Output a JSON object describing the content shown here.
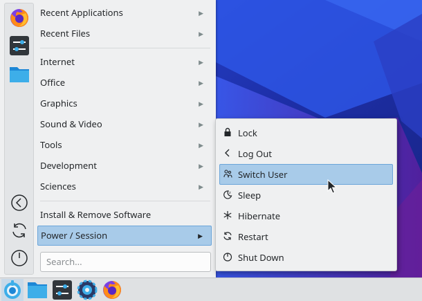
{
  "menu": {
    "items": [
      {
        "label": "Recent Applications",
        "arrow": "▶"
      },
      {
        "label": "Recent Files",
        "arrow": "▶"
      },
      {
        "label": "Internet",
        "arrow": "▶"
      },
      {
        "label": "Office",
        "arrow": "▶"
      },
      {
        "label": "Graphics",
        "arrow": "▶"
      },
      {
        "label": "Sound & Video",
        "arrow": "▶"
      },
      {
        "label": "Tools",
        "arrow": "▶"
      },
      {
        "label": "Development",
        "arrow": "▶"
      },
      {
        "label": "Sciences",
        "arrow": "▶"
      },
      {
        "label": "Install & Remove Software"
      },
      {
        "label": "Power / Session",
        "arrow": "▶"
      }
    ],
    "search_placeholder": "Search..."
  },
  "favorites": [
    "firefox-icon",
    "system-settings-icon",
    "file-manager-icon"
  ],
  "strip_actions": [
    "back-icon",
    "refresh-icon",
    "power-icon"
  ],
  "submenu": {
    "items": [
      {
        "label": "Lock",
        "icon": "lock-icon"
      },
      {
        "label": "Log Out",
        "icon": "logout-icon"
      },
      {
        "label": "Switch User",
        "icon": "switch-user-icon"
      },
      {
        "label": "Sleep",
        "icon": "sleep-icon"
      },
      {
        "label": "Hibernate",
        "icon": "hibernate-icon"
      },
      {
        "label": "Restart",
        "icon": "restart-icon"
      },
      {
        "label": "Shut Down",
        "icon": "shutdown-icon"
      }
    ]
  },
  "taskbar": {
    "items": [
      "launcher-icon",
      "file-manager-icon",
      "system-settings-icon",
      "discover-icon",
      "firefox-icon"
    ]
  },
  "colors": {
    "highlight": "#a8cbe9",
    "highlight_border": "#6ba5d9",
    "panel": "#eff0f1",
    "wallpaper": "#1a2a8f"
  }
}
